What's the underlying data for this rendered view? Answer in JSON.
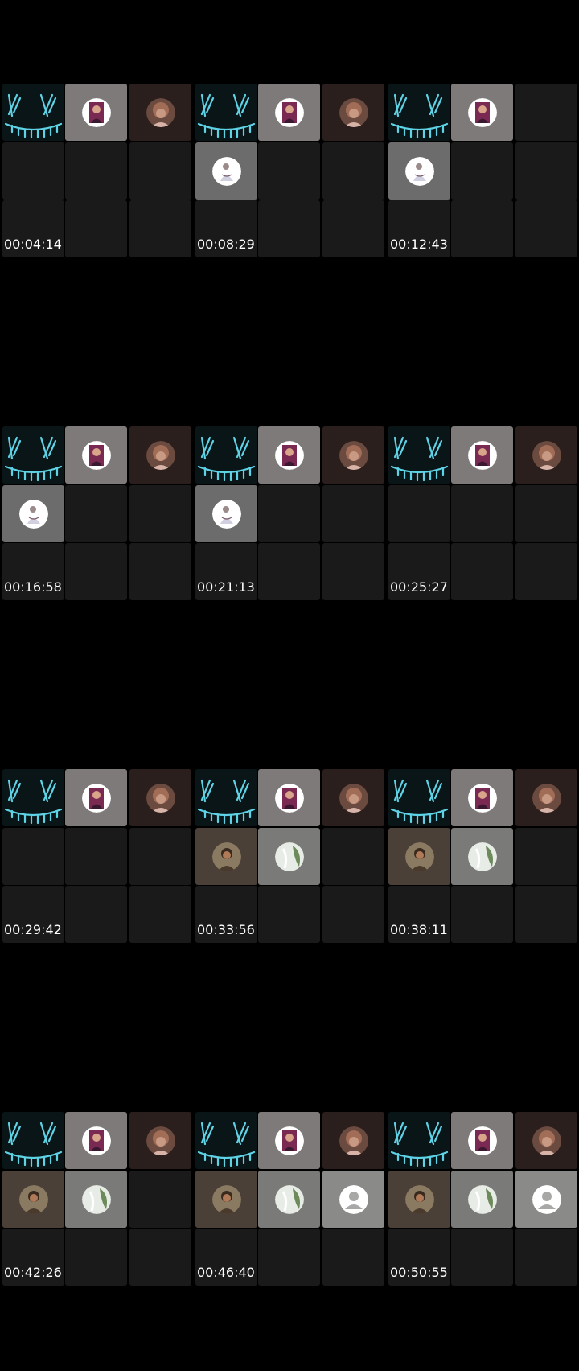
{
  "frames": [
    {
      "timestamp": "00:04:14",
      "tiles": [
        "mask",
        "avatar-woman",
        "avatar-hair",
        "empty",
        "empty",
        "empty",
        "empty",
        "empty",
        "empty"
      ]
    },
    {
      "timestamp": "00:08:29",
      "tiles": [
        "mask",
        "avatar-woman",
        "avatar-hair",
        "avatar-white",
        "empty",
        "empty",
        "empty",
        "empty",
        "empty"
      ]
    },
    {
      "timestamp": "00:12:43",
      "tiles": [
        "mask",
        "avatar-woman",
        "empty",
        "avatar-white",
        "empty",
        "empty",
        "empty",
        "empty",
        "empty"
      ]
    },
    {
      "timestamp": "00:16:58",
      "tiles": [
        "mask",
        "avatar-woman",
        "avatar-hair",
        "avatar-white",
        "empty",
        "empty",
        "empty",
        "empty",
        "empty"
      ]
    },
    {
      "timestamp": "00:21:13",
      "tiles": [
        "mask",
        "avatar-woman",
        "avatar-hair",
        "avatar-white",
        "empty",
        "empty",
        "empty",
        "empty",
        "empty"
      ]
    },
    {
      "timestamp": "00:25:27",
      "tiles": [
        "mask",
        "avatar-woman",
        "avatar-hair",
        "empty",
        "empty",
        "empty",
        "empty",
        "empty",
        "empty"
      ]
    },
    {
      "timestamp": "00:29:42",
      "tiles": [
        "mask",
        "avatar-woman",
        "avatar-hair",
        "empty",
        "empty",
        "empty",
        "empty",
        "empty",
        "empty"
      ]
    },
    {
      "timestamp": "00:33:56",
      "tiles": [
        "mask",
        "avatar-woman",
        "avatar-hair",
        "avatar-man",
        "avatar-green",
        "empty",
        "empty",
        "empty",
        "empty"
      ]
    },
    {
      "timestamp": "00:38:11",
      "tiles": [
        "mask",
        "avatar-woman",
        "avatar-hair",
        "avatar-man",
        "avatar-green",
        "empty",
        "empty",
        "empty",
        "empty"
      ]
    },
    {
      "timestamp": "00:42:26",
      "tiles": [
        "mask",
        "avatar-woman",
        "avatar-hair",
        "avatar-man",
        "avatar-green",
        "empty",
        "empty",
        "empty",
        "empty"
      ]
    },
    {
      "timestamp": "00:46:40",
      "tiles": [
        "mask",
        "avatar-woman",
        "avatar-hair",
        "avatar-man",
        "avatar-green",
        "avatar-default",
        "empty",
        "empty",
        "empty"
      ]
    },
    {
      "timestamp": "00:50:55",
      "tiles": [
        "mask",
        "avatar-woman",
        "avatar-hair",
        "avatar-man",
        "avatar-green",
        "avatar-default",
        "empty",
        "empty",
        "empty"
      ]
    }
  ],
  "colors": {
    "background": "#000000",
    "empty_tile": "#1a1a1a",
    "mask_glow": "#5fd3e6",
    "timestamp_text": "#ffffff"
  }
}
